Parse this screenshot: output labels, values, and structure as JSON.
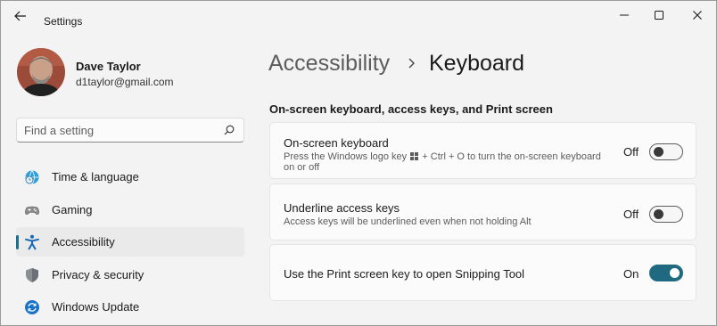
{
  "window": {
    "app_title": "Settings",
    "controls": [
      "minimize-icon",
      "maximize-icon",
      "close-icon"
    ]
  },
  "profile": {
    "name": "Dave Taylor",
    "email": "d1taylor@gmail.com"
  },
  "search": {
    "placeholder": "Find a setting",
    "value": ""
  },
  "sidebar": {
    "items": [
      {
        "label": "Time & language",
        "icon": "globe-clock-icon",
        "selected": false
      },
      {
        "label": "Gaming",
        "icon": "gamepad-icon",
        "selected": false
      },
      {
        "label": "Accessibility",
        "icon": "accessibility-icon",
        "selected": true
      },
      {
        "label": "Privacy & security",
        "icon": "shield-icon",
        "selected": false
      },
      {
        "label": "Windows Update",
        "icon": "update-icon",
        "selected": false
      }
    ]
  },
  "main": {
    "breadcrumb_parent": "Accessibility",
    "page_title": "Keyboard",
    "section_title": "On-screen keyboard, access keys, and Print screen",
    "settings": [
      {
        "title": "On-screen keyboard",
        "desc_line1_pre": "Press the Windows logo key",
        "desc_line1_post": "+ Ctrl + O to turn the on-screen keyboard",
        "desc_line2": "on or off",
        "state_label": "Off",
        "on": false
      },
      {
        "title": "Underline access keys",
        "desc_line1": "Access keys will be underlined even when not holding Alt",
        "state_label": "Off",
        "on": false
      },
      {
        "title": "Use the Print screen key to open Snipping Tool",
        "state_label": "On",
        "on": true
      }
    ]
  },
  "colors": {
    "accent": "#1f6a80",
    "window_bg": "#f3f3f3",
    "card_bg": "#fbfbfb",
    "selected_nav_bg": "#eaeaea"
  }
}
